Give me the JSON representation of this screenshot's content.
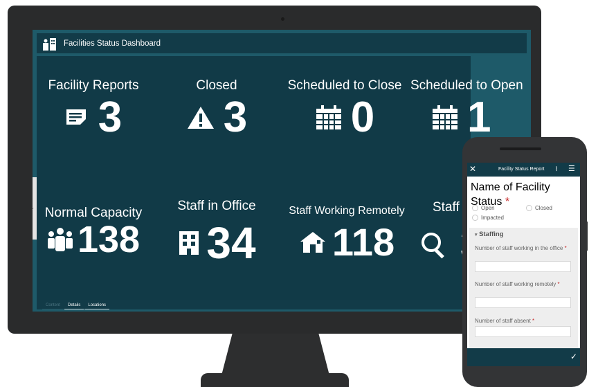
{
  "dashboard": {
    "title": "Facilities Status Dashboard",
    "tiles": [
      {
        "label": "Facility Reports",
        "value": "3",
        "icon": "report-icon"
      },
      {
        "label": "Closed",
        "value": "3",
        "icon": "warning-icon"
      },
      {
        "label": "Scheduled to Close",
        "value": "0",
        "icon": "calendar-icon"
      },
      {
        "label": "Scheduled to Open",
        "value": "1",
        "icon": "calendar-icon"
      },
      {
        "label": "Normal Capacity",
        "value": "138",
        "icon": "people-icon"
      },
      {
        "label": "Staff in Office",
        "value": "34",
        "icon": "building-icon"
      },
      {
        "label": "Staff Working Remotely",
        "value": "118",
        "icon": "home-icon"
      },
      {
        "label": "Staff A",
        "value": "3",
        "icon": "search-icon"
      }
    ],
    "tabs": [
      "Content",
      "Details",
      "Locations"
    ]
  },
  "phone": {
    "title": "Facility Status Report",
    "name_label": "Name of Facility",
    "status_label": "Status",
    "required_mark": "*",
    "options": [
      "Open",
      "Closed",
      "Impacted"
    ],
    "section": "Staffing",
    "fields": [
      {
        "label": "Number of staff working in the office"
      },
      {
        "label": "Number of staff working remotely"
      },
      {
        "label": "Number of staff absent"
      }
    ]
  },
  "colors": {
    "header": "#123b48",
    "body": "#113a47",
    "frame": "#1e5a69",
    "monitor": "#2a2b2c"
  }
}
